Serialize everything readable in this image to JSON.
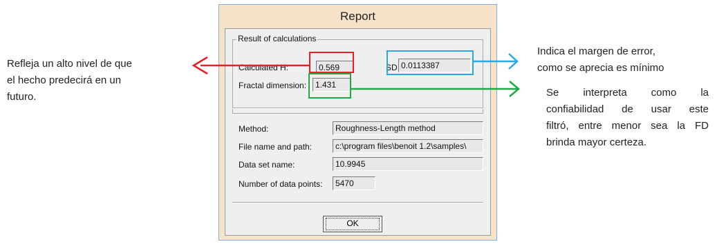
{
  "window": {
    "title": "Report"
  },
  "results": {
    "group_label": "Result of calculations",
    "calc_h_label": "Calculated H:",
    "calc_h_value": "0.569",
    "sd_label": "SD",
    "sd_value": "0.0113387",
    "fd_label": "Fractal dimension:",
    "fd_value": "1.431"
  },
  "details": {
    "method_label": "Method:",
    "method_value": "Roughness-Length method",
    "path_label": "File name and path:",
    "path_value": "c:\\program files\\benoit 1.2\\samples\\",
    "dataset_label": "Data set name:",
    "dataset_value": "10.9945",
    "points_label": "Number of data points:",
    "points_value": "5470"
  },
  "ok_button": "OK",
  "annotations": {
    "left_lines": [
      "Refleja un alto nivel de que",
      "el hecho predecirá en un",
      "futuro."
    ],
    "right_top_lines": [
      "Indica el margen de error,",
      "como se aprecia es mínimo"
    ],
    "right_bottom_lines": [
      "Se interpreta como la",
      "confiabilidad de usar este",
      "filtró, entre menor sea la FD",
      "brinda mayor certeza."
    ]
  },
  "colors": {
    "red": "#ee1c25",
    "blue": "#2aa7e0",
    "green": "#1fa845"
  }
}
